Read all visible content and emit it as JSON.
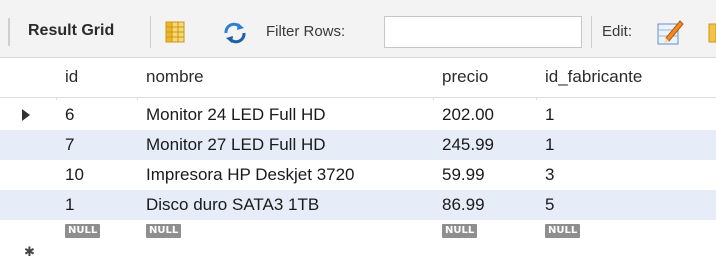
{
  "toolbar": {
    "title": "Result Grid",
    "filter_label": "Filter Rows:",
    "filter_value": "",
    "edit_label": "Edit:"
  },
  "grid": {
    "columns": [
      "id",
      "nombre",
      "precio",
      "id_fabricante"
    ],
    "rows": [
      {
        "id": "6",
        "nombre": "Monitor 24 LED Full HD",
        "precio": "202.00",
        "id_fabricante": "1"
      },
      {
        "id": "7",
        "nombre": "Monitor 27 LED Full HD",
        "precio": "245.99",
        "id_fabricante": "1"
      },
      {
        "id": "10",
        "nombre": "Impresora HP Deskjet 3720",
        "precio": "59.99",
        "id_fabricante": "3"
      },
      {
        "id": "1",
        "nombre": "Disco duro SATA3 1TB",
        "precio": "86.99",
        "id_fabricante": "5"
      }
    ],
    "null_label": "NULL"
  },
  "icons": {
    "grid": "grid-view-icon",
    "refresh": "refresh-arrows-icon",
    "edit": "edit-pencil-icon",
    "current_row": "current-row-arrow-icon",
    "new_row": "new-row-star-icon"
  },
  "colors": {
    "toolbar_bg": "#f3f3f3",
    "alt_row": "#e6edf8",
    "null_badge": "#8e8e8e"
  }
}
